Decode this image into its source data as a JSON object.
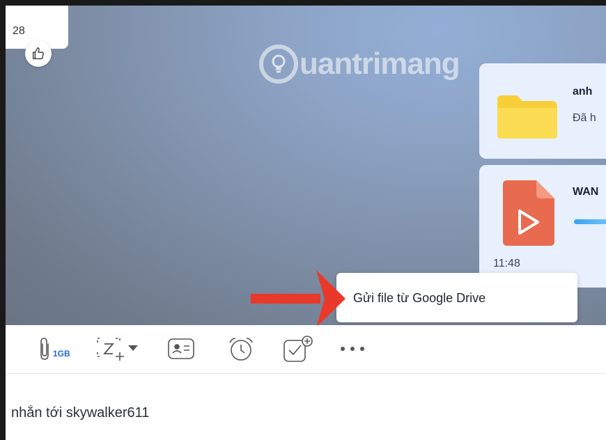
{
  "chat": {
    "partial_message_text": "28",
    "watermark_text": "uantrimang"
  },
  "file_cards": [
    {
      "name": "anh",
      "status": "Đã h",
      "icon": "folder-icon"
    },
    {
      "name": "WAN",
      "time": "11:48",
      "icon": "video-file-icon",
      "progress": 0.6
    }
  ],
  "tooltip": {
    "text": "Gửi file từ Google Drive"
  },
  "toolbar": {
    "attach_size_label": "1GB",
    "tools": [
      "attach-file-icon",
      "screenshot-icon",
      "contact-card-icon",
      "reminder-icon",
      "task-icon",
      "more-icon"
    ]
  },
  "composer": {
    "placeholder": "nhắn tới skywalker611"
  },
  "colors": {
    "accent": "#1e6ae0",
    "card_bg": "#e7f0fc",
    "arrow": "#e8392b"
  }
}
